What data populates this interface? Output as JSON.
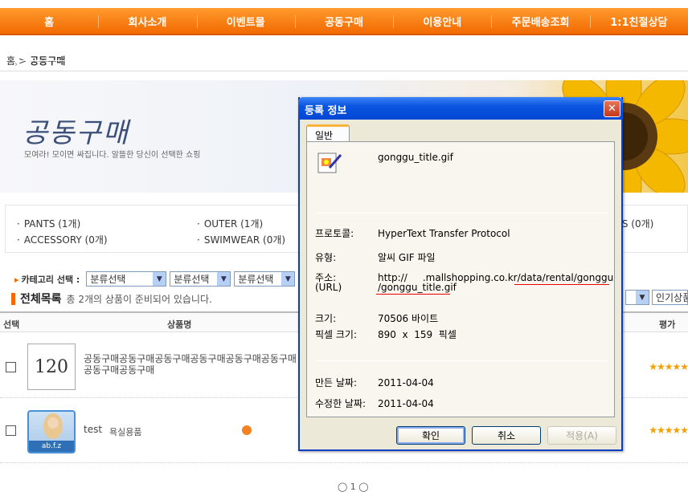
{
  "nav": [
    "홈",
    "회사소개",
    "이벤트몰",
    "공동구매",
    "이용안내",
    "주문배송조회",
    "1:1친절상담"
  ],
  "breadcrumb": {
    "home": "홈",
    "current": "공동구매"
  },
  "banner": {
    "title": "공동구매",
    "subtitle": "모여라! 모이면 싸집니다. 알뜰한 당신이 선택한 쇼핑"
  },
  "categories": [
    "PANTS (1개)",
    "OUTER (1개)",
    "ACCESSORY (0개)",
    "SWIMWEAR (0개)",
    "S (0개)"
  ],
  "category_select": {
    "label": "카테고리 선택 :",
    "options": [
      "분류선택",
      "분류선택",
      "분류선택"
    ]
  },
  "list": {
    "title": "전체목록",
    "desc": "총 2개의 상품이 준비되어 있습니다.",
    "sort": "인기상품"
  },
  "table": {
    "col_select": "선택",
    "col_name": "상품명",
    "col_rating": "평가"
  },
  "products": [
    {
      "thumb": "120",
      "name": "공동구매공동구매공동구매공동구매공동구매공동구매공동구매공동구매",
      "stars": "★★★★★"
    },
    {
      "thumb": "ab.f.z",
      "name": "test",
      "category": "욕실용품",
      "stars": "★★★★★"
    }
  ],
  "pager": "◯ 1 ◯",
  "dialog": {
    "title": "등록 정보",
    "close": "✕",
    "tab": "일반",
    "filename": "gonggu_title.gif",
    "protocol_label": "프로토콜:",
    "protocol": "HyperText Transfer Protocol",
    "type_label": "유형:",
    "type": "알씨 GIF 파일",
    "address_label": "주소:",
    "address_label2": "(URL)",
    "url_line1": "http://     .mallshopping.co.kr/data/rental/gonggu",
    "url_line2": "/gonggu_title.gif",
    "size_label": "크기:",
    "size": "70506 바이트",
    "pixel_label": "픽셀 크기:",
    "pixel": "890  x  159  픽셀",
    "created_label": "만든 날짜:",
    "created": "2011-04-04",
    "modified_label": "수정한 날짜:",
    "modified": "2011-04-04",
    "ok": "확인",
    "cancel": "취소",
    "apply": "적용(A)"
  }
}
